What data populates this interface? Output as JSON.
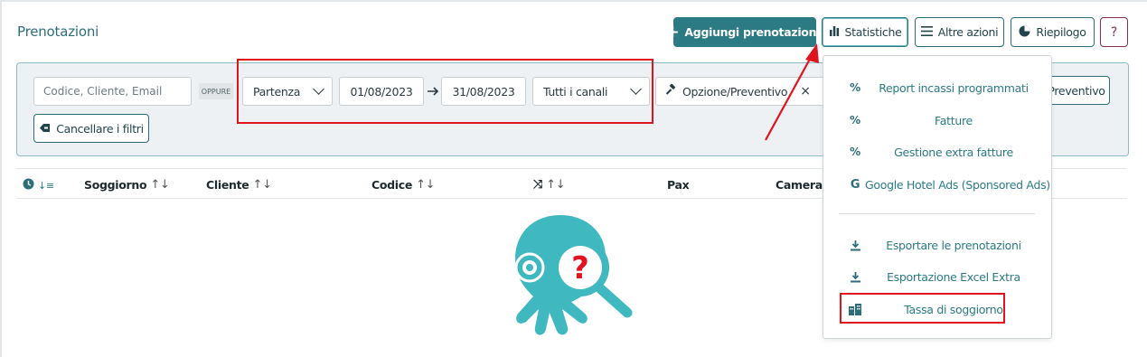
{
  "header": {
    "title": "Prenotazioni",
    "buttons": {
      "add": "Aggiungi prenotazione",
      "stats": "Statistiche",
      "more": "Altre azioni",
      "summary": "Riepilogo",
      "help": "?"
    }
  },
  "filters": {
    "search_placeholder": "Codice, Cliente, Email",
    "or_label": "OPPURE",
    "date_type": "Partenza",
    "date_from": "01/08/2023",
    "date_to": "31/08/2023",
    "channels": "Tutti i canali",
    "option_chip": "Opzione/Preventivo",
    "preventivo_button": "Preventivo",
    "clear_button": "Cancellare i filtri"
  },
  "table": {
    "columns": [
      "Soggiorno",
      "Cliente",
      "Codice",
      "",
      "Pax",
      "Camera"
    ]
  },
  "menu": {
    "items": [
      {
        "label": "Report incassi programmati",
        "icon": "percent-icon"
      },
      {
        "label": "Fatture",
        "icon": "percent-icon"
      },
      {
        "label": "Gestione extra fatture",
        "icon": "percent-icon"
      },
      {
        "label": "Google Hotel Ads (Sponsored Ads)",
        "icon": "google-icon"
      },
      {
        "label": "Esportare le prenotazioni",
        "icon": "download-icon"
      },
      {
        "label": "Esportazione Excel Extra",
        "icon": "download-icon"
      },
      {
        "label": "Tassa di soggiorno",
        "icon": "building-icon"
      }
    ]
  },
  "colors": {
    "accent": "#2b7a84",
    "highlight": "#e0141e",
    "mascot": "#3fb8c0"
  }
}
